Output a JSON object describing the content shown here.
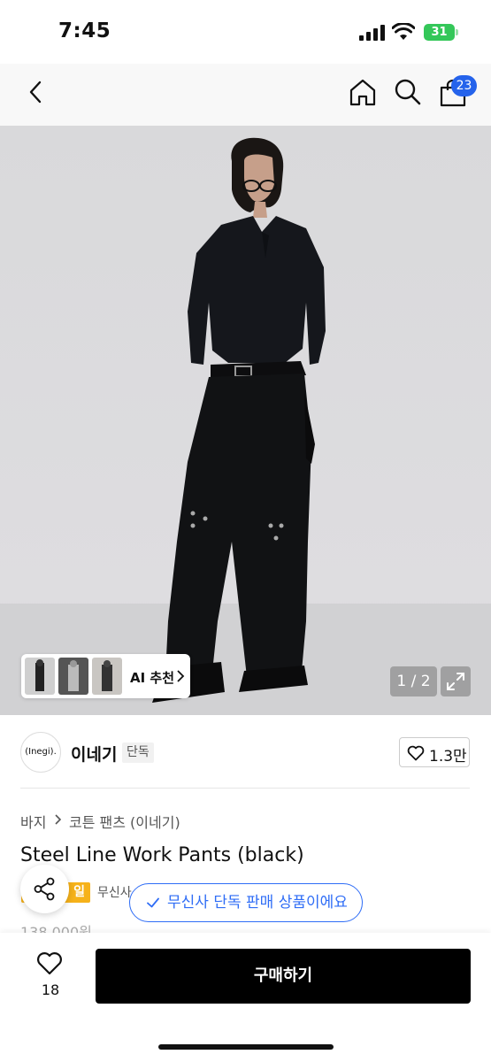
{
  "status": {
    "time": "7:45",
    "battery": "31"
  },
  "nav": {
    "cart_count": "23"
  },
  "gallery": {
    "page_counter": "1 / 2",
    "ai_label": "AI 추천"
  },
  "brand": {
    "logo_text": "(Inegi).",
    "name": "이네기",
    "badge": "단독",
    "likes": "1.3만"
  },
  "breadcrumb": [
    "바지",
    "코튼 팬츠 (이네기)"
  ],
  "product": {
    "title": "Steel Line Work Pants (black)",
    "sale_tag": "일",
    "exclusive_label_partial": "무신사",
    "exclusive_tooltip": "무신사 단독 판매 상품이에요",
    "price_partial": "138,000원"
  },
  "bottom": {
    "wish_count": "18",
    "buy_label": "구매하기"
  },
  "colors": {
    "accent_blue": "#2f6df6",
    "badge_blue": "#2563eb",
    "sale_yellow": "#f6b21a",
    "battery_green": "#34c759"
  }
}
